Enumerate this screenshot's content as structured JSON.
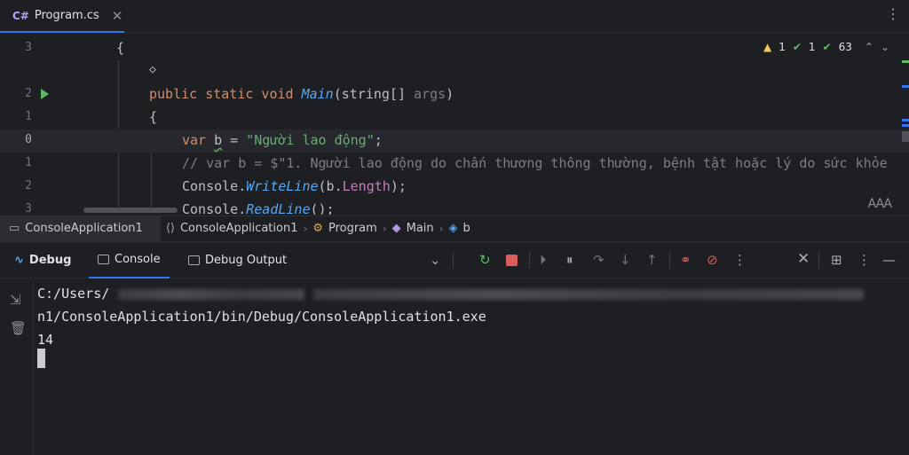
{
  "tab": {
    "icon_label": "C#",
    "file_name": "Program.cs",
    "close": "✕"
  },
  "inspections": {
    "warnings": "1",
    "weak_warnings": "1",
    "typos": "63"
  },
  "editor": {
    "lines": [
      {
        "num": "3",
        "indent": 1,
        "text": "{"
      },
      {
        "num": "",
        "indent": 2,
        "text": "◇"
      },
      {
        "num": "2",
        "indent": 2,
        "kw": "public static void ",
        "fn": "Main",
        "rest1": "(string[] ",
        "param": "args",
        "rest2": ")"
      },
      {
        "num": "1",
        "indent": 2,
        "text": "{"
      },
      {
        "num": "0",
        "indent": 3,
        "kw": "var ",
        "var": "b",
        "mid": " = ",
        "str": "\"Người lao động\"",
        "end": ";"
      },
      {
        "num": "1",
        "indent": 3,
        "cmt": "// var b = $\"1. Người lao động do chấn thương thông thường, bệnh tật hoặc lý do sức khỏe"
      },
      {
        "num": "2",
        "indent": 3,
        "obj": "Console.",
        "fn": "WriteLine",
        "a": "(b.",
        "prop": "Length",
        "b": ");"
      },
      {
        "num": "3",
        "indent": 3,
        "obj": "Console.",
        "fn": "ReadLine",
        "b": "();"
      }
    ]
  },
  "reader_mode": "AAA",
  "breadcrumb": {
    "project": "ConsoleApplication1",
    "namespace": "ConsoleApplication1",
    "class": "Program",
    "method": "Main",
    "variable": "b"
  },
  "toolwindow": {
    "debug_label": "Debug",
    "console_label": "Console",
    "output_label": "Debug Output"
  },
  "console": {
    "line1": "C:/Users/",
    "line2": "n1/ConsoleApplication1/bin/Debug/ConsoleApplication1.exe",
    "line3": "14"
  },
  "colors": {
    "accent": "#3574f0",
    "run": "#5fb865",
    "stop": "#db5c5c"
  }
}
